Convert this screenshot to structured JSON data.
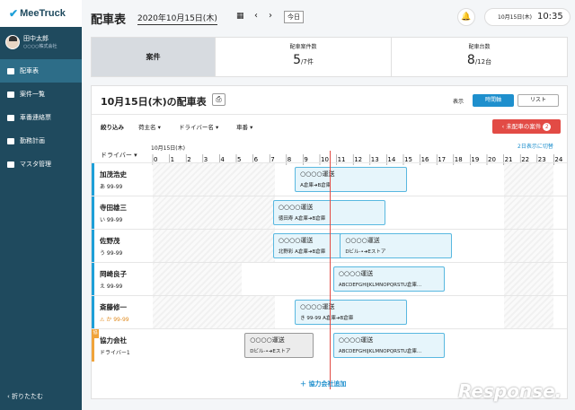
{
  "sidebar": {
    "brand": "MeeTruck",
    "user_name": "田中太郎",
    "company": "○○○○株式会社",
    "items": [
      {
        "label": "配車表"
      },
      {
        "label": "案件一覧"
      },
      {
        "label": "車番連絡票"
      },
      {
        "label": "勤務計画"
      },
      {
        "label": "マスタ管理"
      }
    ],
    "collapse": "折りたたむ"
  },
  "header": {
    "title": "配車表",
    "date": "2020年10月15日(木)",
    "today": "今日",
    "clock_date": "10月15日(木)",
    "clock_time": "10:35"
  },
  "summary": {
    "label": "案件",
    "cases_label": "配車案件数",
    "cases_value": "5",
    "cases_total": "/7件",
    "trucks_label": "配車台数",
    "trucks_value": "8",
    "trucks_total": "/12台"
  },
  "panel": {
    "title": "10月15日(木)の配車表",
    "display_label": "表示",
    "btn_timeline": "時間軸",
    "btn_list": "リスト",
    "filter": "絞り込み",
    "f1": "荷主名",
    "f2": "ドライバー名",
    "f3": "車番",
    "unassigned": "未配車の案件",
    "unassigned_count": "2",
    "driver_col": "ドライバー",
    "two_day": "2日表示に切替",
    "date_header": "10月15日(木)",
    "add_partner": "協力会社追加",
    "hours": [
      "0",
      "1",
      "2",
      "3",
      "4",
      "5",
      "6",
      "7",
      "8",
      "9",
      "10",
      "11",
      "12",
      "13",
      "14",
      "15",
      "16",
      "17",
      "18",
      "19",
      "20",
      "21",
      "22",
      "23",
      "24"
    ]
  },
  "rows": [
    {
      "name": "加茂浩史",
      "plate": "あ 99-99",
      "partner": false,
      "hatch": [
        [
          0,
          7.3
        ],
        [
          21,
          24
        ]
      ],
      "cards": [
        {
          "s": 8.5,
          "e": 15.2,
          "title": "○○○○運送",
          "sub": "A倉庫➜B倉庫"
        }
      ]
    },
    {
      "name": "寺田雄三",
      "plate": "い 99-99",
      "partner": false,
      "hatch": [
        [
          0,
          7.3
        ],
        [
          21,
          24
        ]
      ],
      "cards": [
        {
          "s": 7.2,
          "e": 13.9,
          "title": "○○○○運送",
          "sub": "徳田寿  A倉庫➜B倉庫"
        }
      ]
    },
    {
      "name": "佐野茂",
      "plate": "う 99-99",
      "partner": false,
      "hatch": [
        [
          0,
          7.3
        ],
        [
          21,
          24
        ]
      ],
      "cards": [
        {
          "s": 7.2,
          "e": 13.9,
          "title": "○○○○運送",
          "sub": "北野彩  A倉庫➜B倉庫"
        },
        {
          "s": 11.2,
          "e": 17.9,
          "title": "○○○○運送",
          "sub": "Dビル-•➜Eストア"
        }
      ]
    },
    {
      "name": "岡崎良子",
      "plate": "え 99-99",
      "partner": false,
      "hatch": [
        [
          0,
          5.3
        ],
        [
          21,
          24
        ]
      ],
      "cards": [
        {
          "s": 10.8,
          "e": 17.5,
          "title": "○○○○運送",
          "sub": "ABCDEFGHIJKLMNOPQRSTU倉庫..."
        }
      ]
    },
    {
      "name": "斎藤修一",
      "plate": "か 99-99",
      "partner": false,
      "warn": true,
      "hatch": [
        [
          0,
          7.3
        ],
        [
          21,
          24
        ]
      ],
      "cards": [
        {
          "s": 8.5,
          "e": 15.2,
          "title": "○○○○運送",
          "sub": "き 99-99  A倉庫➜B倉庫"
        }
      ]
    },
    {
      "name": "協力会社",
      "plate": "ドライバー1",
      "partner": true,
      "hatch": [],
      "cards": [
        {
          "s": 5.5,
          "e": 9.6,
          "title": "○○○○運送",
          "sub": "Dビル-•➜Eストア",
          "gray": true
        },
        {
          "s": 10.8,
          "e": 17.5,
          "title": "○○○○運送",
          "sub": "ABCDEFGHIJKLMNOPQRSTU倉庫..."
        }
      ]
    }
  ],
  "now_hour": 10.58,
  "colors": {
    "primary": "#1e8fcd",
    "sidebar": "#1f4a5e",
    "alert": "#e24b45"
  }
}
